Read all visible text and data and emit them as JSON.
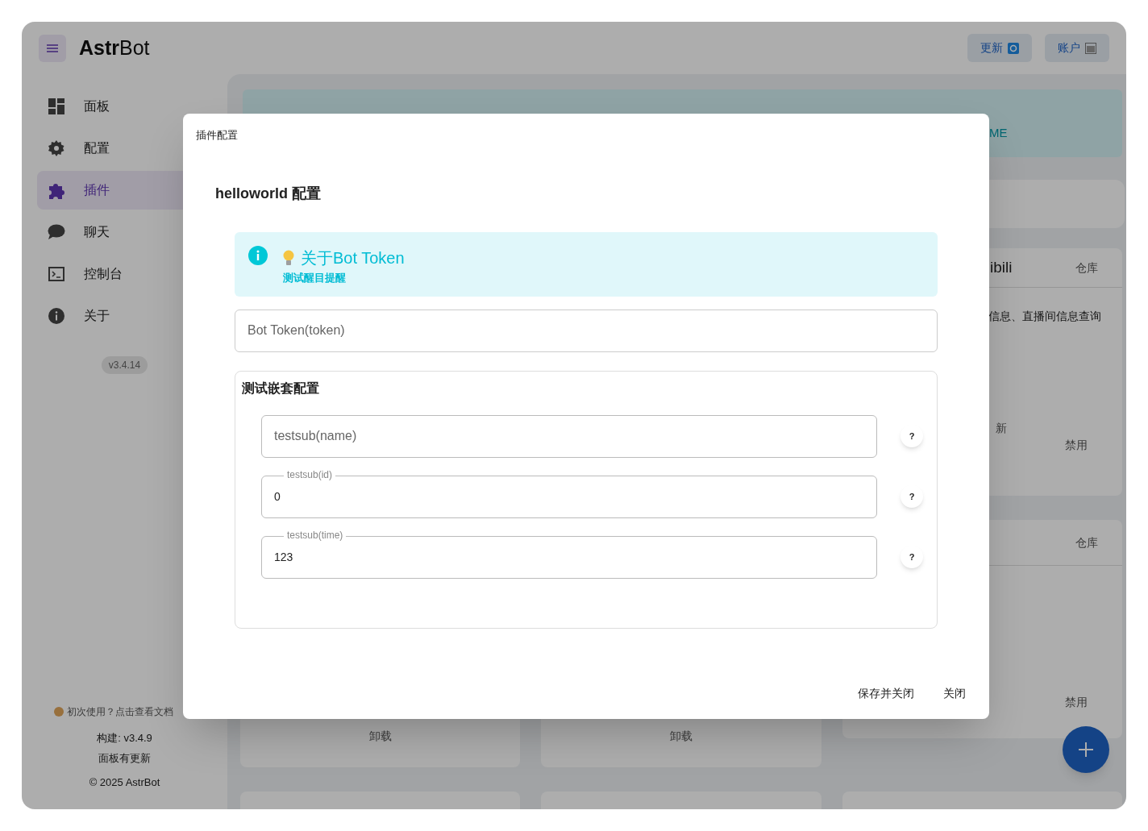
{
  "header": {
    "logo": {
      "bold": "Astr",
      "regular": "Bot"
    },
    "buttons": [
      {
        "label": "更新",
        "kind": "update"
      },
      {
        "label": "账户",
        "kind": "account"
      }
    ]
  },
  "sidebar": {
    "items": [
      {
        "label": "面板",
        "kind": "dashboard",
        "selected": false
      },
      {
        "label": "配置",
        "kind": "settings",
        "selected": false
      },
      {
        "label": "插件",
        "kind": "puzzle",
        "selected": true
      },
      {
        "label": "聊天",
        "kind": "chat",
        "selected": false
      },
      {
        "label": "控制台",
        "kind": "terminal",
        "selected": false
      },
      {
        "label": "关于",
        "kind": "info",
        "selected": false
      }
    ],
    "version": "v3.4.14",
    "help": "初次使用？点击查看文档",
    "build": "构建: v3.4.9",
    "update_notice": "面板有更新",
    "copyright": "© 2025 AstrBot"
  },
  "background": {
    "alert_text": "ME",
    "cards": [
      {
        "title": "ibili",
        "link": "仓库",
        "description": "信息、直播间信息查询",
        "note": "新",
        "action": "禁用"
      },
      {
        "link": "仓库",
        "action": "禁用"
      }
    ],
    "left_cards": [
      {
        "action": "卸载"
      },
      {
        "action": "卸载"
      }
    ]
  },
  "dialog": {
    "title": "插件配置",
    "heading": "helloworld 配置",
    "alert": {
      "title": "关于Bot Token",
      "subtitle": "测试醒目提醒"
    },
    "field": {
      "placeholder": "Bot Token(token)"
    },
    "group": {
      "title": "测试嵌套配置",
      "fields": [
        {
          "placeholder": "testsub(name)",
          "help": "?"
        },
        {
          "label": "testsub(id)",
          "value": "0",
          "help": "?"
        },
        {
          "label": "testsub(time)",
          "value": "123",
          "help": "?"
        }
      ]
    },
    "actions": [
      "保存并关闭",
      "关闭"
    ]
  }
}
